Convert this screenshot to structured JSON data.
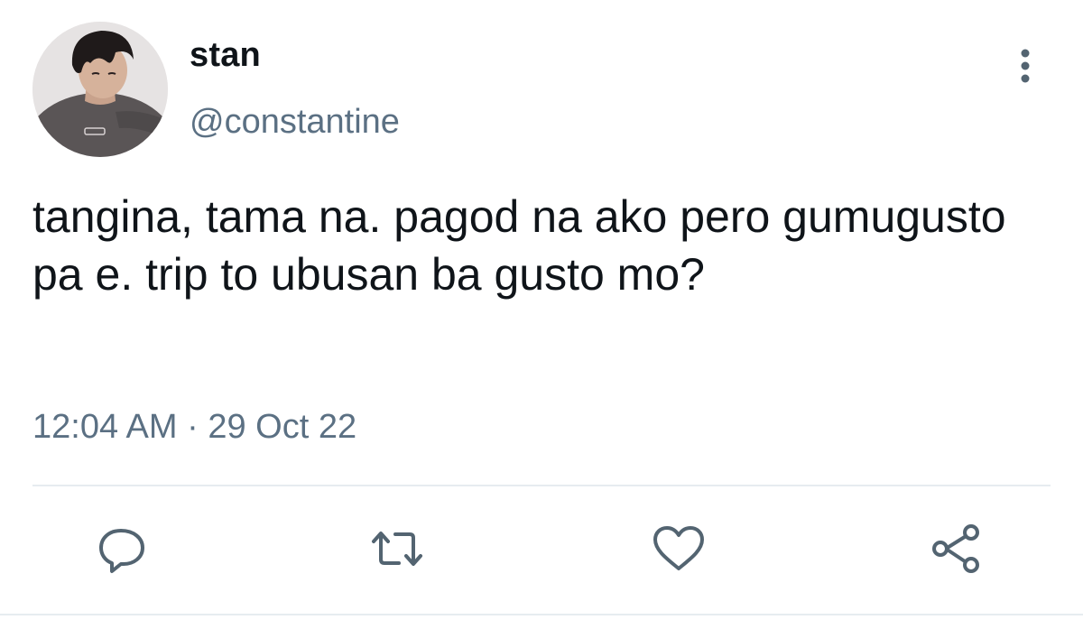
{
  "tweet": {
    "display_name": "stan",
    "handle": "@constantine",
    "text": "tangina, tama na. pagod na ako pero gumugusto pa e. trip to ubusan ba gusto mo?",
    "time": "12:04 AM",
    "separator": "·",
    "date": "29 Oct 22"
  },
  "actions": {
    "reply_icon": "reply-icon",
    "retweet_icon": "retweet-icon",
    "like_icon": "heart-icon",
    "share_icon": "share-icon",
    "more_icon": "more-vertical-icon"
  },
  "colors": {
    "text": "#0f1419",
    "secondary": "#5b7083",
    "divider": "#e6ecf0",
    "icon": "#536471"
  }
}
